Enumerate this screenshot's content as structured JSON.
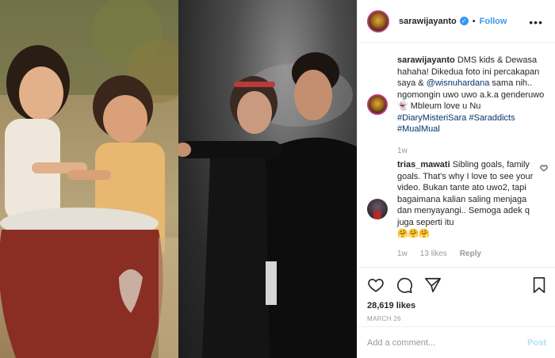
{
  "header": {
    "username": "sarawijayanto",
    "separator": "•",
    "follow_label": "Follow",
    "more_icon": "more-horizontal-icon"
  },
  "caption": {
    "username": "sarawijayanto",
    "text_before_mention": " DMS kids & Dewasa hahaha! Dikedua foto ini percakapan saya & ",
    "mention": "@wisnuhardana",
    "text_after_mention": " sama nih.. ngomongin uwo uwo a.k.a genderuwo 👻 Mbleum love u Nu",
    "hashtags": [
      "#DiaryMisteriSara",
      "#Saraddicts",
      "#MualMual"
    ],
    "time": "1w"
  },
  "comment": {
    "username": "trias_mawati",
    "text": " Sibling goals, family goals. That's why I love to see your video. Bukan tante ato uwo2, tapi bagaimana kalian saling menjaga dan menyayangi.. Semoga adek q juga seperti itu",
    "emoji": "🤗🤗🤗",
    "time": "1w",
    "likes": "13 likes",
    "reply_label": "Reply"
  },
  "actions": {
    "likes": "28,619 likes",
    "date": "March 26"
  },
  "add_comment": {
    "placeholder": "Add a comment...",
    "post_label": "Post"
  },
  "colors": {
    "link": "#3897f0",
    "hashtag": "#003569",
    "muted": "#999999",
    "border": "#efefef"
  }
}
